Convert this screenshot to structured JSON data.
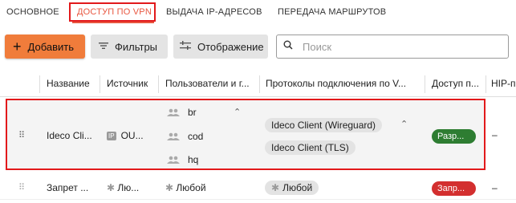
{
  "tabs": [
    {
      "label": "ОСНОВНОЕ",
      "active": false
    },
    {
      "label": "ДОСТУП ПО VPN",
      "active": true
    },
    {
      "label": "ВЫДАЧА IP-АДРЕСОВ",
      "active": false
    },
    {
      "label": "ПЕРЕДАЧА МАРШРУТОВ",
      "active": false
    }
  ],
  "toolbar": {
    "add_label": "Добавить",
    "filters_label": "Фильтры",
    "view_label": "Отображение",
    "search_placeholder": "Поиск"
  },
  "table": {
    "columns": [
      "Название",
      "Источник",
      "Пользователи и г...",
      "Протоколы подключения по V...",
      "Доступ п...",
      "HIP-п"
    ],
    "rows": [
      {
        "name": "Ideco Cli...",
        "source_tag": "IP",
        "source": "OU...",
        "users": [
          "br",
          "cod",
          "hq"
        ],
        "protocols": [
          "Ideco Client (Wireguard)",
          "Ideco Client (TLS)"
        ],
        "access": "Разр...",
        "hip": "–",
        "selected": true
      },
      {
        "name": "Запрет ...",
        "source": "Лю...",
        "users": [
          "Любой"
        ],
        "protocols": [
          "Любой"
        ],
        "access": "Запр...",
        "hip": "–",
        "selected": false
      }
    ]
  },
  "colors": {
    "accent": "#e8563f",
    "add_button": "#f07c3b",
    "allow_badge": "#2e7d32",
    "deny_badge": "#d32f2f",
    "highlight_border": "#e2191b"
  }
}
